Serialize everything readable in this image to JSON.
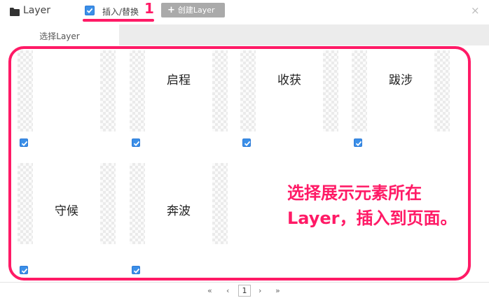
{
  "header": {
    "title": "Layer",
    "insert_label": "插入/替换",
    "step_number": "1",
    "create_button": "创建Layer",
    "close_symbol": "×"
  },
  "tabs": [
    {
      "label": "选择Layer"
    }
  ],
  "cards": [
    {
      "label": "",
      "checked": true
    },
    {
      "label": "启程",
      "checked": true
    },
    {
      "label": "收获",
      "checked": true
    },
    {
      "label": "跋涉",
      "checked": true
    },
    {
      "label": "守候",
      "checked": true
    },
    {
      "label": "奔波",
      "checked": true
    }
  ],
  "annotation": {
    "line1": "选择展示元素所在",
    "line2": "Layer，插入到页面。"
  },
  "pager": {
    "first": "«",
    "prev": "‹",
    "current": "1",
    "next": "›",
    "last": "»"
  },
  "colors": {
    "accent": "#ff1a66",
    "checkbox": "#3b8fe8"
  }
}
